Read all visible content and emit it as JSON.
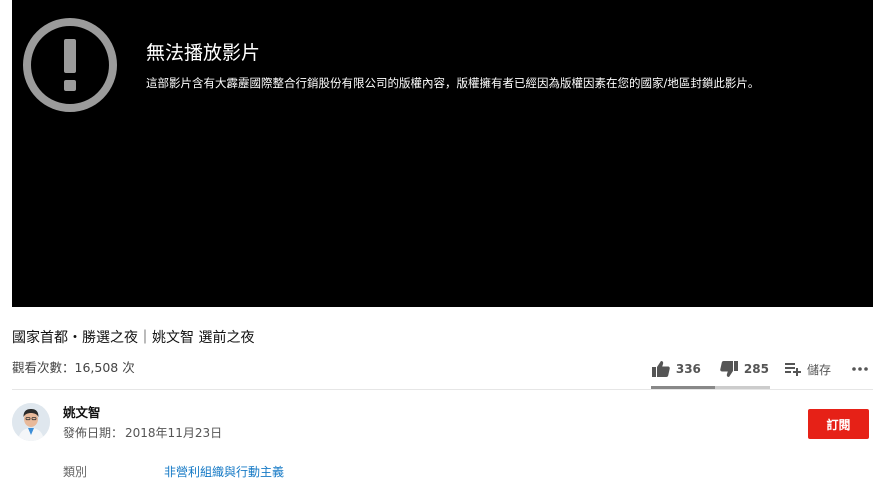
{
  "player": {
    "error_title": "無法播放影片",
    "error_message": "這部影片含有大霹靂國際整合行銷股份有限公司的版權內容，版權擁有者已經因為版權因素在您的國家/地區封鎖此影片。",
    "error_icon": "error-exclamation-icon"
  },
  "video": {
    "title": "國家首都・勝選之夜｜姚文智 選前之夜",
    "views": "觀看次數：16,508 次"
  },
  "actions": {
    "like_count": "336",
    "dislike_count": "285",
    "save_label": "儲存",
    "like_ratio": 0.54
  },
  "channel": {
    "name": "姚文智",
    "publish_label": "發佈日期：",
    "publish_date": "2018年11月23日",
    "subscribe_label": "訂閱"
  },
  "meta": {
    "category_label": "類別",
    "category_value": "非營利組織與行動主義"
  },
  "colors": {
    "subscribe": "#e62117",
    "link": "#167ac6",
    "player_bg": "#000000"
  }
}
